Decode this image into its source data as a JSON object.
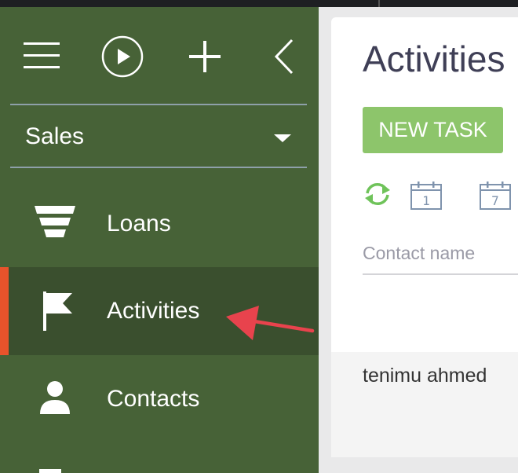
{
  "sidebar": {
    "section_label": "Sales",
    "items": [
      {
        "label": "Loans",
        "icon": "funnel-icon"
      },
      {
        "label": "Activities",
        "icon": "flag-icon",
        "active": true
      },
      {
        "label": "Contacts",
        "icon": "person-icon"
      }
    ]
  },
  "main": {
    "title": "Activities",
    "new_task_label": "NEW TASK",
    "calendar_day_label": "1",
    "calendar_week_label": "7",
    "column_header": "Contact name",
    "rows": [
      {
        "contact_name": "tenimu ahmed"
      }
    ]
  },
  "colors": {
    "sidebar_bg": "#476237",
    "active_item_bg": "#3a4f2e",
    "active_accent": "#e8532b",
    "new_task_button": "#8dc56b",
    "annotation_arrow": "#e8434d"
  }
}
